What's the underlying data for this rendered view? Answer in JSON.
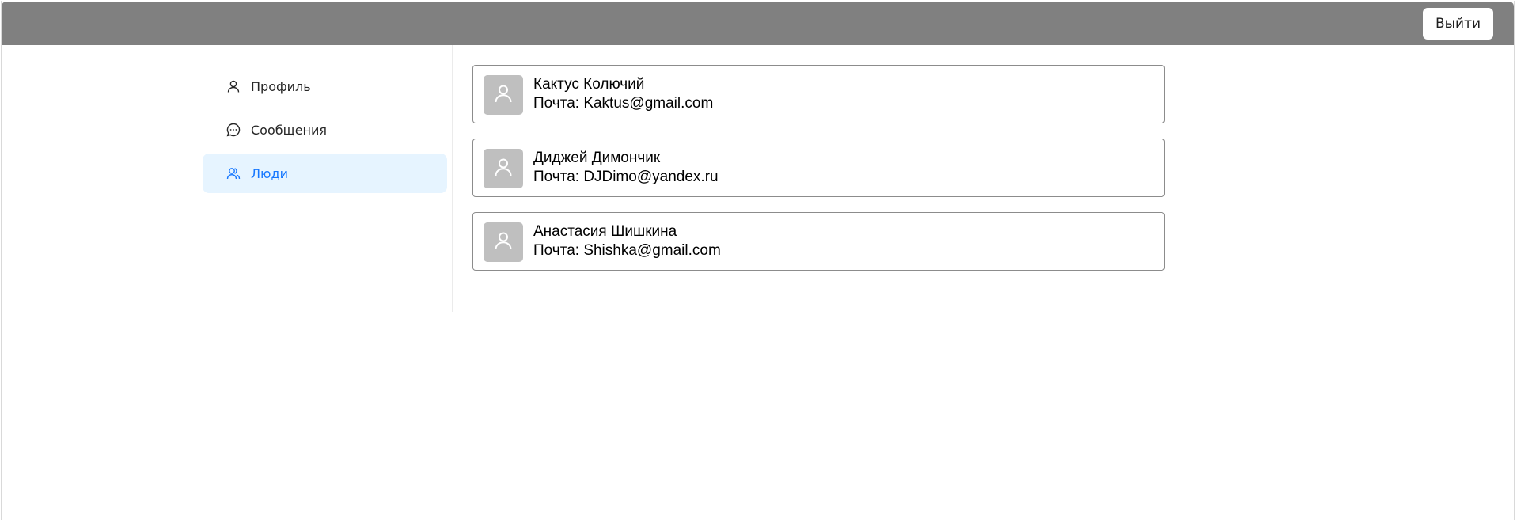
{
  "header": {
    "logout_label": "Выйти"
  },
  "sidebar": {
    "items": [
      {
        "label": "Профиль",
        "icon": "user-icon",
        "active": false
      },
      {
        "label": "Сообщения",
        "icon": "message-icon",
        "active": false
      },
      {
        "label": "Люди",
        "icon": "team-icon",
        "active": true
      }
    ]
  },
  "people": [
    {
      "name": "Кактус Колючий",
      "email": "Почта: Kaktus@gmail.com",
      "icon": "user-icon"
    },
    {
      "name": "Диджей Димончик",
      "email": "Почта: DJDimo@yandex.ru",
      "icon": "user-icon"
    },
    {
      "name": "Анастасия Шишкина",
      "email": "Почта: Shishka@gmail.com",
      "icon": "user-icon"
    }
  ],
  "colors": {
    "header_bg": "#808080",
    "active_bg": "#e6f4ff",
    "active_text": "#1677ff",
    "avatar_bg": "#bfbfbf",
    "card_border": "#8c8c8c"
  }
}
